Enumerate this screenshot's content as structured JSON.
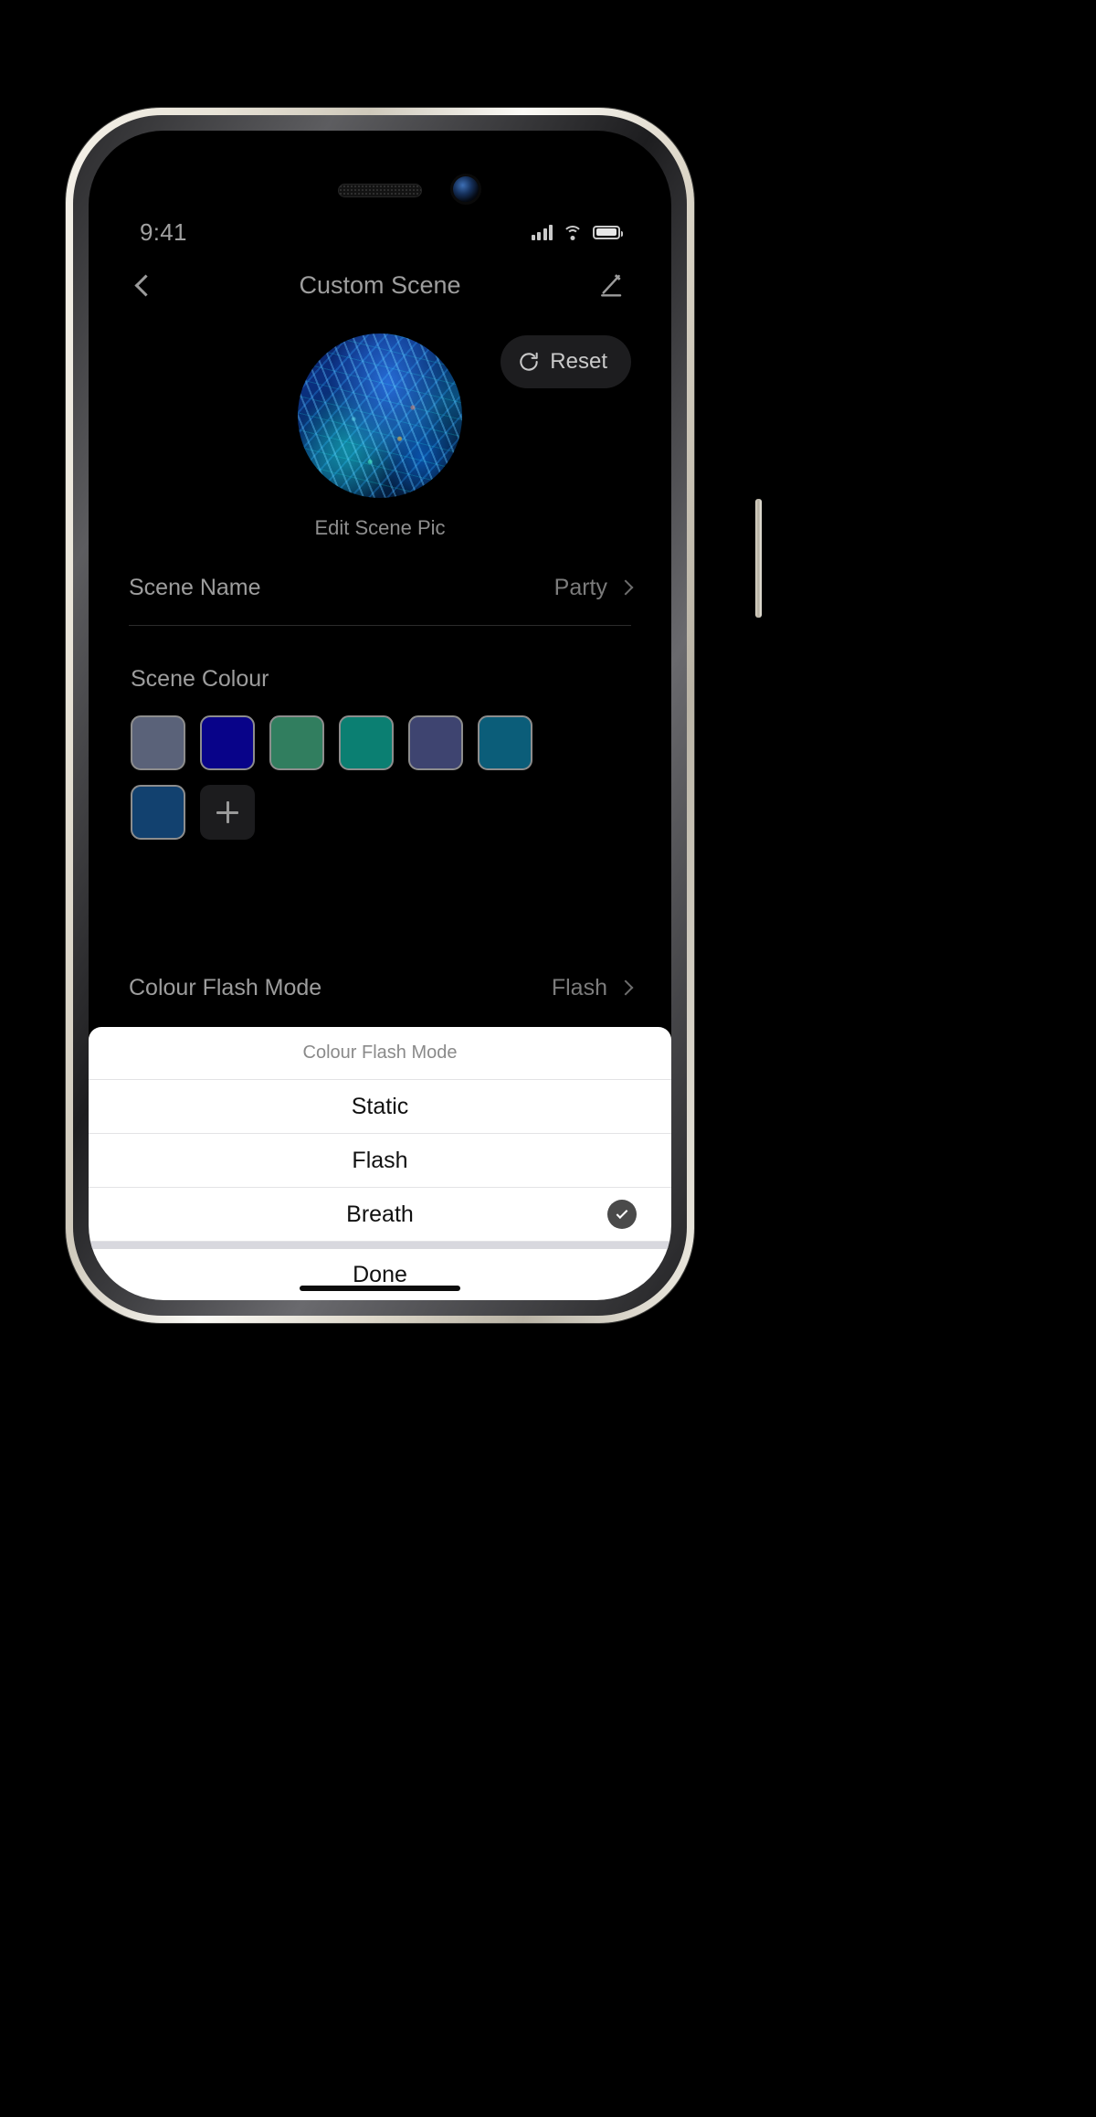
{
  "status_bar": {
    "time": "9:41",
    "battery_level_pct": 92
  },
  "nav": {
    "title": "Custom Scene",
    "back_icon": "chevron-left-icon",
    "edit_icon": "pencil-edit-icon"
  },
  "scene_pic": {
    "label": "Edit Scene Pic"
  },
  "reset": {
    "label": "Reset",
    "icon": "refresh-circle-icon"
  },
  "rows": {
    "scene_name": {
      "label": "Scene Name",
      "value": "Party"
    },
    "flash_mode": {
      "label": "Colour Flash Mode",
      "value": "Flash"
    }
  },
  "scene_colour": {
    "title": "Scene Colour",
    "add_label": "+",
    "swatches": [
      {
        "name": "slate-blue-grey",
        "hex": "#5a6279"
      },
      {
        "name": "navy-blue",
        "hex": "#080389"
      },
      {
        "name": "sea-green",
        "hex": "#317e5f"
      },
      {
        "name": "teal",
        "hex": "#0b7f72"
      },
      {
        "name": "dark-slate-blue",
        "hex": "#3e4470"
      },
      {
        "name": "teal-blue",
        "hex": "#0b5d79"
      },
      {
        "name": "deep-blue",
        "hex": "#12416f"
      }
    ]
  },
  "action_sheet": {
    "title": "Colour Flash Mode",
    "options": [
      {
        "label": "Static",
        "selected": false
      },
      {
        "label": "Flash",
        "selected": false
      },
      {
        "label": "Breath",
        "selected": true
      }
    ],
    "done_label": "Done"
  }
}
